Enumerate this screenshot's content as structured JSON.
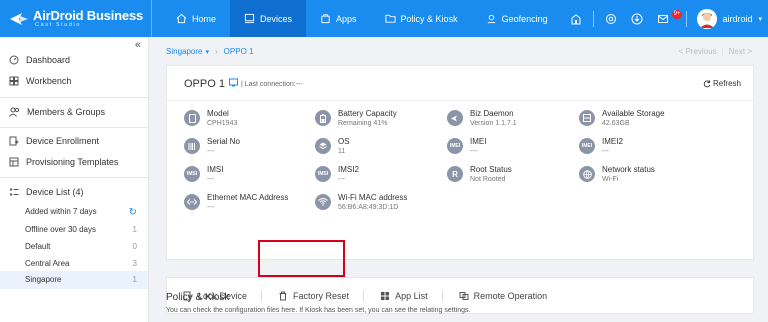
{
  "brand": {
    "name": "AirDroid Business",
    "tagline": "Cast Studio"
  },
  "nav": [
    {
      "label": "Home",
      "icon": "home-icon"
    },
    {
      "label": "Devices",
      "icon": "devices-icon",
      "active": true
    },
    {
      "label": "Apps",
      "icon": "apps-icon"
    },
    {
      "label": "Policy & Kiosk",
      "icon": "folder-icon"
    },
    {
      "label": "Geofencing",
      "icon": "geofencing-icon"
    }
  ],
  "topright": {
    "badge": "9+",
    "username": "airdroid"
  },
  "sidebar": {
    "items": [
      {
        "label": "Dashboard"
      },
      {
        "label": "Workbench"
      },
      {
        "label": "Members & Groups"
      },
      {
        "label": "Device Enrollment"
      },
      {
        "label": "Provisioning Templates"
      },
      {
        "label": "Device List (4)"
      }
    ],
    "sub": [
      {
        "label": "Added within 7 days",
        "count": ""
      },
      {
        "label": "Offline over 30 days",
        "count": "1"
      },
      {
        "label": "Default",
        "count": "0"
      },
      {
        "label": "Central Area",
        "count": "3"
      },
      {
        "label": "Singapore",
        "count": "1",
        "active": true
      }
    ]
  },
  "breadcrumb": {
    "group": "Singapore",
    "device": "OPPO 1"
  },
  "pager": {
    "prev": "< Previous",
    "next": "Next >"
  },
  "device": {
    "name": "OPPO 1",
    "last_connection": "| Last connection:---",
    "refresh": "Refresh",
    "info": [
      {
        "label": "Model",
        "value": "CPH1943",
        "icon": "phone-icon"
      },
      {
        "label": "Battery Capacity",
        "value": "Remaining 41%",
        "icon": "battery-icon"
      },
      {
        "label": "Biz Daemon",
        "value": "Version 1.1.7.1",
        "icon": "daemon-icon"
      },
      {
        "label": "Available Storage",
        "value": "42.63GB",
        "icon": "storage-icon"
      },
      {
        "label": "Serial No",
        "value": "---",
        "icon": "barcode-icon"
      },
      {
        "label": "OS",
        "value": "11",
        "icon": "os-icon"
      },
      {
        "label": "IMEI",
        "value": "---",
        "icon": "imei-icon",
        "text": "IMEI"
      },
      {
        "label": "IMEI2",
        "value": "---",
        "icon": "imei2-icon",
        "text": "IMEI"
      },
      {
        "label": "IMSI",
        "value": "---",
        "icon": "imsi-icon",
        "text": "IMSI"
      },
      {
        "label": "IMSI2",
        "value": "---",
        "icon": "imsi2-icon",
        "text": "IMSI"
      },
      {
        "label": "Root Status",
        "value": "Not Rooted",
        "icon": "root-icon",
        "text": "R"
      },
      {
        "label": "Network status",
        "value": "Wi-Fi",
        "icon": "globe-icon"
      },
      {
        "label": "Ethernet MAC Address",
        "value": "---",
        "icon": "ethernet-icon"
      },
      {
        "label": "Wi-Fi MAC address",
        "value": "56:B6:A8:49:3D:1D",
        "icon": "wifi-icon"
      }
    ]
  },
  "actions": [
    {
      "label": "Lock Device"
    },
    {
      "label": "Factory Reset"
    },
    {
      "label": "App List"
    },
    {
      "label": "Remote Operation"
    }
  ],
  "policy": {
    "title": "Policy & Kiosk",
    "desc": "You can check the configuration files here. If Kiosk has been set, you can see the relating settings."
  }
}
